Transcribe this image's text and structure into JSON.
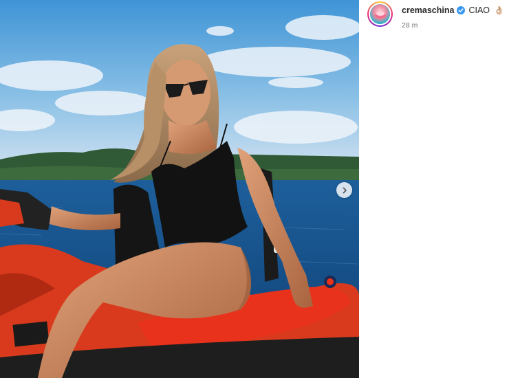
{
  "post": {
    "username": "cremaschina",
    "caption": "CIAO",
    "caption_emoji": "👌🏼",
    "timestamp": "28 m"
  },
  "colors": {
    "verified_blue": "#3897f0",
    "jetski_red": "#e8321c"
  },
  "icons": {
    "verified": "verified-badge-icon",
    "next": "chevron-right-icon"
  }
}
